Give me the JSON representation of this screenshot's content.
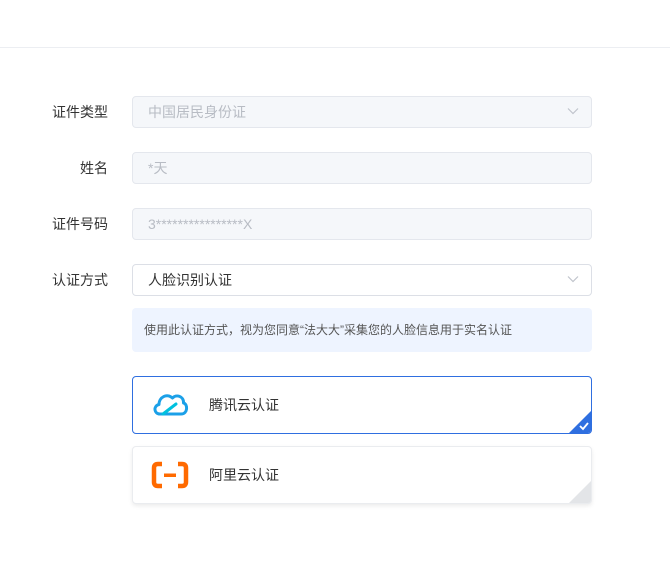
{
  "form": {
    "id_type": {
      "label": "证件类型",
      "value": "中国居民身份证"
    },
    "name": {
      "label": "姓名",
      "value": "*天"
    },
    "id_number": {
      "label": "证件号码",
      "value": "3****************X"
    },
    "auth_method": {
      "label": "认证方式",
      "value": "人脸识别认证"
    }
  },
  "notice": "使用此认证方式，视为您同意“法大大”采集您的人脸信息用于实名认证",
  "options": [
    {
      "label": "腾讯云认证",
      "icon": "tencent-cloud-icon",
      "selected": true
    },
    {
      "label": "阿里云认证",
      "icon": "aliyun-icon",
      "selected": false
    }
  ],
  "colors": {
    "accent": "#2f6fe0",
    "notice_bg": "#eef4ff",
    "aliyun_orange": "#ff6a00",
    "tencent_blue": "#1ba0e8"
  }
}
